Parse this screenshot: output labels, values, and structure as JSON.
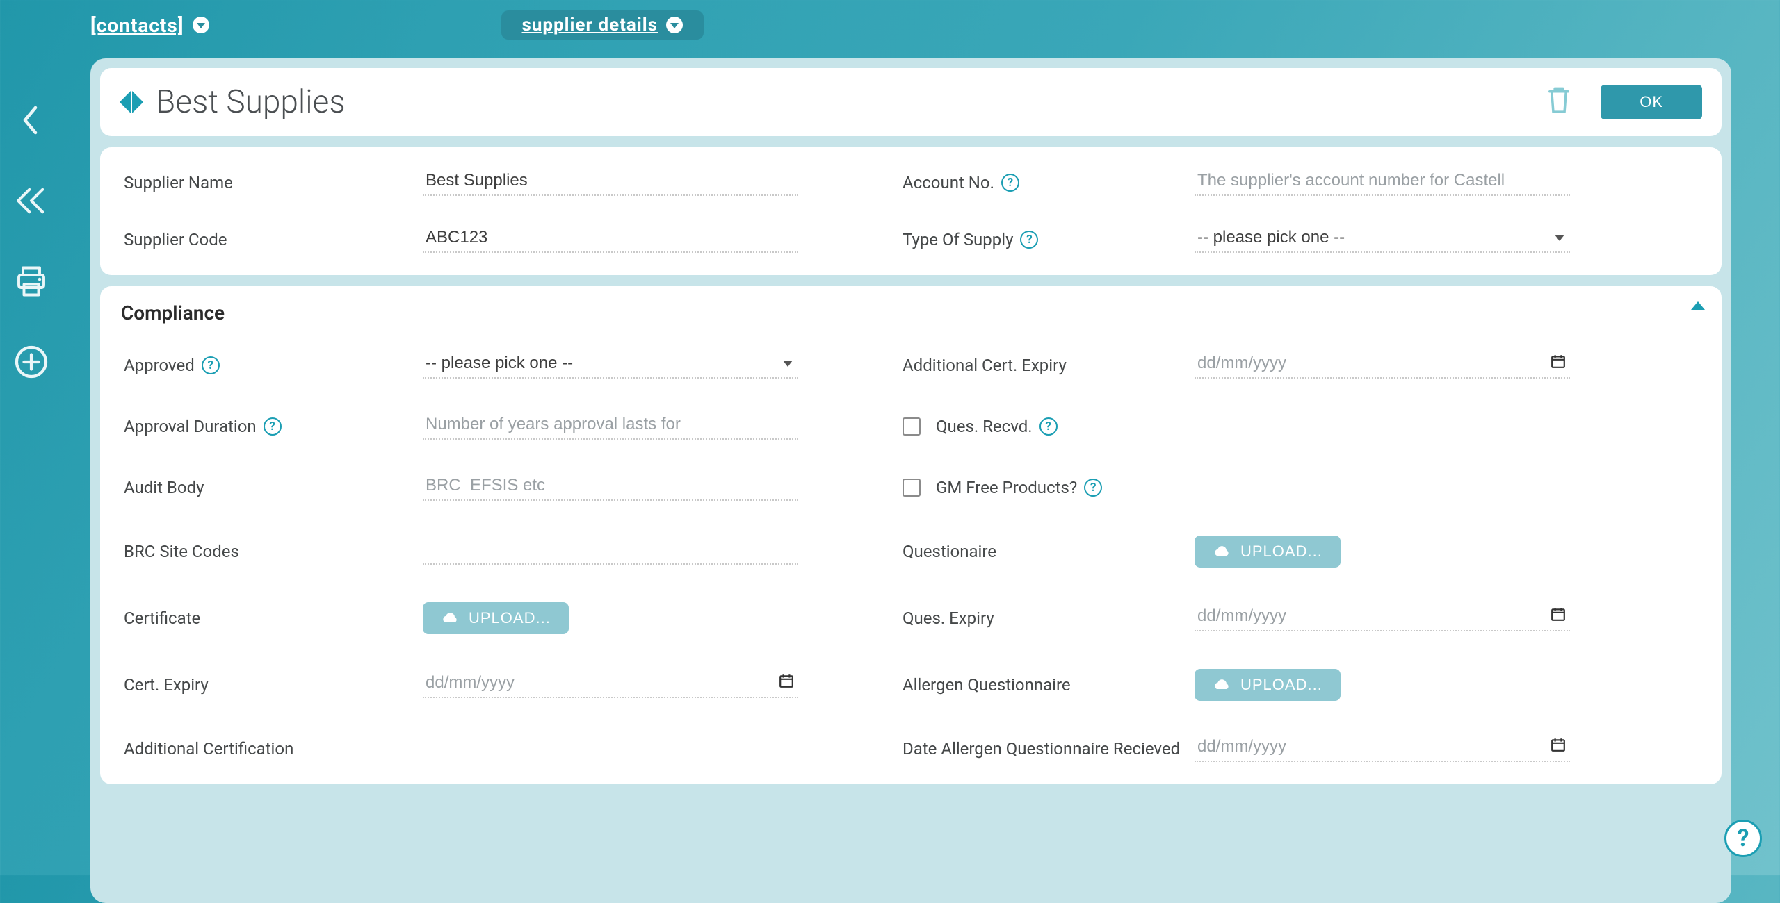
{
  "nav": {
    "contacts_label": "[contacts]",
    "supplier_details_label": "supplier details"
  },
  "header": {
    "title": "Best Supplies",
    "ok_label": "OK"
  },
  "supplier": {
    "name_label": "Supplier Name",
    "name_value": "Best Supplies",
    "code_label": "Supplier Code",
    "code_value": "ABC123",
    "account_label": "Account No.",
    "account_placeholder": "The supplier's account number for Castell",
    "type_label": "Type Of Supply",
    "type_value": "-- please pick one --"
  },
  "compliance": {
    "section_title": "Compliance",
    "approved_label": "Approved",
    "approved_value": "-- please pick one --",
    "approval_duration_label": "Approval Duration",
    "approval_duration_placeholder": "Number of years approval lasts for",
    "audit_body_label": "Audit Body",
    "audit_body_placeholder": "BRC  EFSIS etc",
    "brc_label": "BRC Site Codes",
    "certificate_label": "Certificate",
    "cert_expiry_label": "Cert. Expiry",
    "additional_cert_label": "Additional Certification",
    "add_cert_expiry_label": "Additional Cert. Expiry",
    "ques_recvd_label": "Ques. Recvd.",
    "gm_free_label": "GM Free Products?",
    "questionaire_label": "Questionaire",
    "ques_expiry_label": "Ques. Expiry",
    "allergen_q_label": "Allergen Questionnaire",
    "date_allergen_label": "Date Allergen Questionnaire Recieved",
    "upload_label": "UPLOAD...",
    "date_placeholder": "dd/mm/yyyy"
  }
}
